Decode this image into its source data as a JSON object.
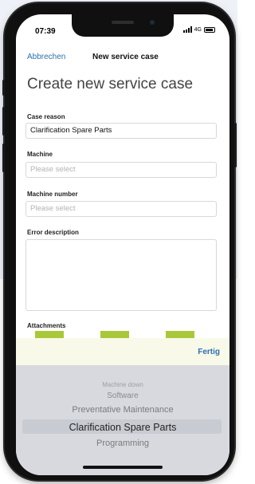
{
  "status_bar": {
    "time": "07:39",
    "network": "4G"
  },
  "nav": {
    "cancel_label": "Abbrechen",
    "title": "New service case"
  },
  "page_title": "Create new service case",
  "form": {
    "case_reason": {
      "label": "Case reason",
      "value": "Clarification Spare Parts"
    },
    "machine": {
      "label": "Machine",
      "placeholder": "Please select"
    },
    "machine_number": {
      "label": "Machine number",
      "placeholder": "Please select"
    },
    "error_description": {
      "label": "Error description",
      "value": ""
    },
    "attachments": {
      "label": "Attachments",
      "count": 3
    }
  },
  "toolbar": {
    "done_label": "Fertig"
  },
  "picker": {
    "options": [
      "Machine down",
      "Software",
      "Preventative Maintenance",
      "Clarification Spare Parts",
      "Programming"
    ],
    "selected": "Clarification Spare Parts"
  },
  "colors": {
    "link": "#2d6fb0",
    "attachment_accent": "#a8c83a",
    "picker_bg": "#d7d9de"
  }
}
